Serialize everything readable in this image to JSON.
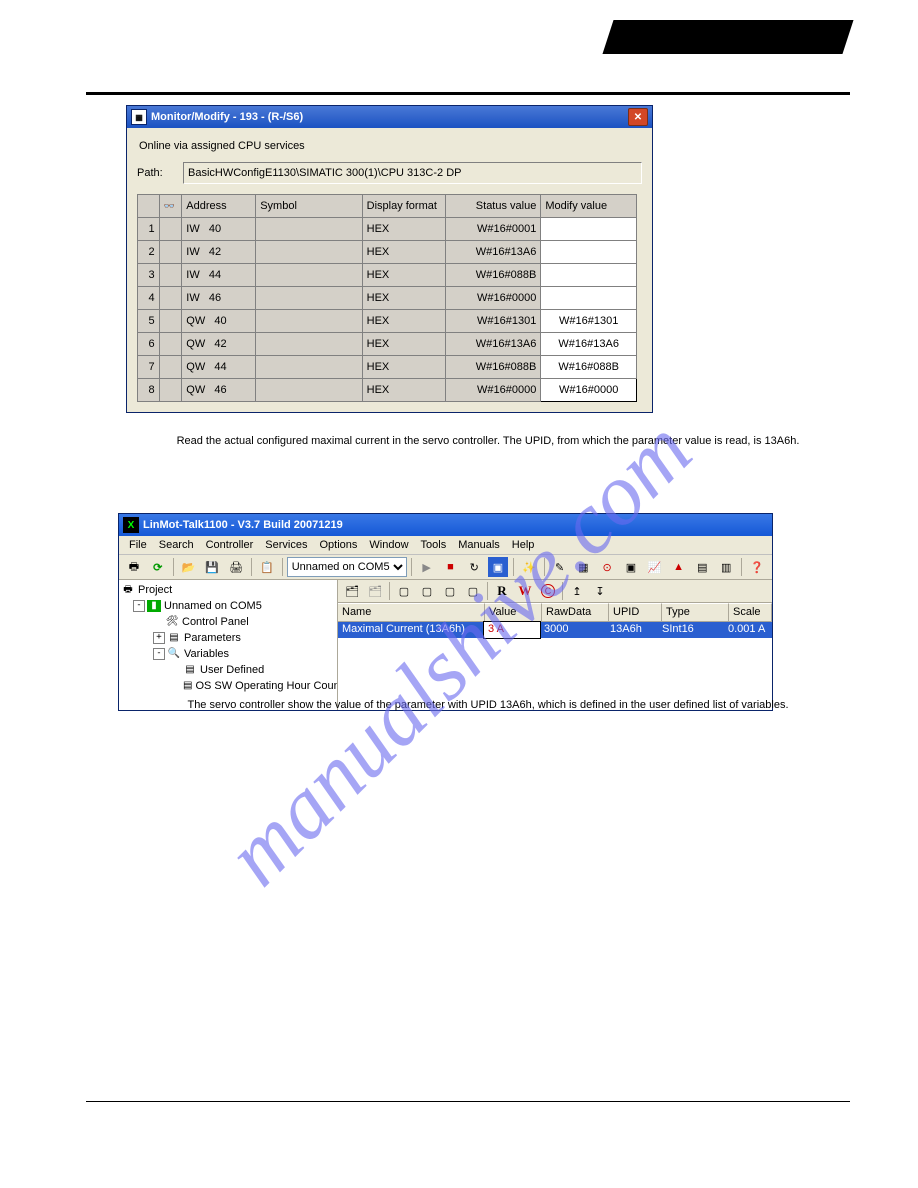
{
  "win1": {
    "title": "Monitor/Modify - 193 - (R-/S6)",
    "online": "Online via assigned CPU services",
    "path_label": "Path:",
    "path_value": "BasicHWConfigE1130\\SIMATIC 300(1)\\CPU 313C-2 DP",
    "headers": {
      "address": "Address",
      "symbol": "Symbol",
      "display": "Display format",
      "status": "Status value",
      "modify": "Modify value"
    },
    "rows": [
      {
        "n": "1",
        "addr": "IW   40",
        "sym": "",
        "disp": "HEX",
        "stat": "W#16#0001",
        "mod": ""
      },
      {
        "n": "2",
        "addr": "IW   42",
        "sym": "",
        "disp": "HEX",
        "stat": "W#16#13A6",
        "mod": ""
      },
      {
        "n": "3",
        "addr": "IW   44",
        "sym": "",
        "disp": "HEX",
        "stat": "W#16#088B",
        "mod": ""
      },
      {
        "n": "4",
        "addr": "IW   46",
        "sym": "",
        "disp": "HEX",
        "stat": "W#16#0000",
        "mod": ""
      },
      {
        "n": "5",
        "addr": "QW   40",
        "sym": "",
        "disp": "HEX",
        "stat": "W#16#1301",
        "mod": "W#16#1301"
      },
      {
        "n": "6",
        "addr": "QW   42",
        "sym": "",
        "disp": "HEX",
        "stat": "W#16#13A6",
        "mod": "W#16#13A6"
      },
      {
        "n": "7",
        "addr": "QW   44",
        "sym": "",
        "disp": "HEX",
        "stat": "W#16#088B",
        "mod": "W#16#088B"
      },
      {
        "n": "8",
        "addr": "QW   46",
        "sym": "",
        "disp": "HEX",
        "stat": "W#16#0000",
        "mod": "W#16#0000"
      }
    ]
  },
  "caption1": "Read the actual configured maximal current in the servo controller. The UPID, from which the parameter value is read, is 13A6h.",
  "win2": {
    "title": "LinMot-Talk1100 - V3.7 Build 20071219",
    "menu": [
      "File",
      "Search",
      "Controller",
      "Services",
      "Options",
      "Window",
      "Tools",
      "Manuals",
      "Help"
    ],
    "combo": "Unnamed on COM5",
    "tree": {
      "root": "Project",
      "node1": "Unnamed on COM5",
      "cp": "Control Panel",
      "params": "Parameters",
      "vars": "Variables",
      "ud": "User Defined",
      "os": "OS SW Operating Hour Counter"
    },
    "tb2_labels": {
      "R": "R",
      "W": "W",
      "C": "C"
    },
    "cols": {
      "name": "Name",
      "value": "Value",
      "raw": "RawData",
      "upid": "UPID",
      "type": "Type",
      "scale": "Scale"
    },
    "row": {
      "name": "Maximal Current  (13A6h)",
      "value": "3 A",
      "raw": "3000",
      "upid": "13A6h",
      "type": "SInt16",
      "scale": "0.001 A"
    }
  },
  "caption2": "The servo controller show the value of the parameter with UPID 13A6h, which is defined in the user defined list of variables.",
  "watermark": "manualshive.com"
}
